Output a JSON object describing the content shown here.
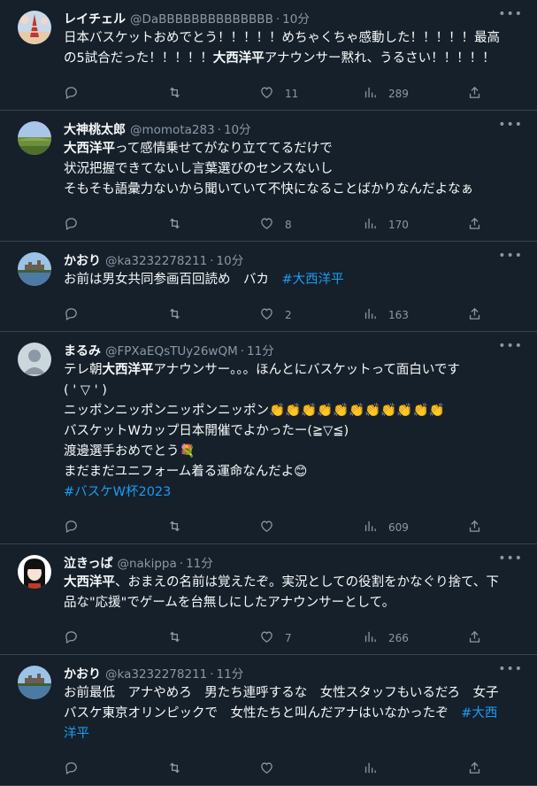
{
  "tweets": [
    {
      "name": "レイチェル",
      "handle": "@DaBBBBBBBBBBBBBB",
      "time": "10分",
      "lines": [
        [
          {
            "t": "日本バスケットおめでとう！！！！！めちゃくちゃ感動した！！！！！最高"
          }
        ],
        [
          {
            "t": "の5試合だった！！！！！"
          },
          {
            "t": "大西洋平",
            "s": "hl"
          },
          {
            "t": "アナウンサー黙れ、うるさい！！！！！"
          }
        ]
      ],
      "reply": "",
      "retweet": "",
      "likes": "11",
      "views": "289",
      "avatar": "tower"
    },
    {
      "name": "大神桃太郎",
      "handle": "@momota283",
      "time": "10分",
      "lines": [
        [
          {
            "t": "大西洋平",
            "s": "hl"
          },
          {
            "t": "って感情乗せてがなり立ててるだけで"
          }
        ],
        [
          {
            "t": "状況把握できてないし言葉選びのセンスないし"
          }
        ],
        [
          {
            "t": "そもそも語彙力ないから聞いていて不快になることばかりなんだよなぁ"
          }
        ]
      ],
      "reply": "",
      "retweet": "",
      "likes": "8",
      "views": "170",
      "avatar": "field"
    },
    {
      "name": "かおり",
      "handle": "@ka3232278211",
      "time": "10分",
      "lines": [
        [
          {
            "t": "お前は男女共同参画百回読め　バカ　"
          },
          {
            "t": "#大西洋平",
            "s": "tag"
          }
        ]
      ],
      "reply": "",
      "retweet": "",
      "likes": "2",
      "views": "163",
      "avatar": "castle"
    },
    {
      "name": "まるみ",
      "handle": "@FPXaEQsTUy26wQM",
      "time": "11分",
      "lines": [
        [
          {
            "t": "テレ朝"
          },
          {
            "t": "大西洋平",
            "s": "hl"
          },
          {
            "t": "アナウンサー。。。ほんとにバスケットって面白いです"
          }
        ],
        [
          {
            "t": "( ' ▽ ' )"
          }
        ],
        [
          {
            "t": "ニッポンニッポンニッポンニッポン👏👏👏👏👏👏👏👏👏👏👏"
          }
        ],
        [
          {
            "t": "バスケットWカップ日本開催でよかったー(≧▽≦)"
          }
        ],
        [
          {
            "t": "渡邊選手おめでとう💐"
          }
        ],
        [
          {
            "t": "まだまだユニフォーム着る運命なんだよ😊"
          }
        ],
        [
          {
            "t": "#バスケW杯2023",
            "s": "tag"
          }
        ]
      ],
      "reply": "",
      "retweet": "",
      "likes": "",
      "views": "609",
      "avatar": "default"
    },
    {
      "name": "泣きっぱ",
      "handle": "@nakippa",
      "time": "11分",
      "lines": [
        [
          {
            "t": "大西洋平",
            "s": "hl"
          },
          {
            "t": "、おまえの名前は覚えたぞ。実況としての役割をかなぐり捨て、下"
          }
        ],
        [
          {
            "t": "品な\"応援\"でゲームを台無しにしたアナウンサーとして。"
          }
        ]
      ],
      "reply": "",
      "retweet": "",
      "likes": "7",
      "views": "266",
      "avatar": "girl"
    },
    {
      "name": "かおり",
      "handle": "@ka3232278211",
      "time": "11分",
      "lines": [
        [
          {
            "t": "お前最低　アナやめろ　男たち連呼するな　女性スタッフもいるだろ　女子"
          }
        ],
        [
          {
            "t": "バスケ東京オリンピックで　女性たちと叫んだアナはいなかったぞ　"
          },
          {
            "t": "#大西",
            "s": "tag"
          }
        ],
        [
          {
            "t": "洋平",
            "s": "tag"
          }
        ]
      ],
      "reply": "",
      "retweet": "",
      "likes": "",
      "views": "",
      "avatar": "castle"
    }
  ],
  "colors": {
    "background": "#15202b",
    "text": "#f7f9f9",
    "muted": "#8b98a5",
    "link": "#1d9bf0",
    "divider": "#38444d"
  }
}
